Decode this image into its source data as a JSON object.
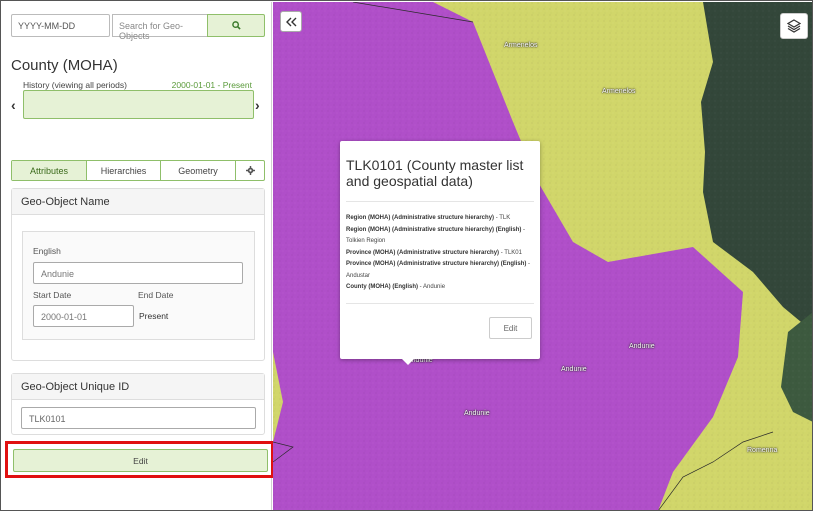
{
  "toolbar": {
    "date_placeholder": "YYYY-MM-DD",
    "search_placeholder": "Search for Geo-Objects",
    "search_icon": "search-icon"
  },
  "geo_object": {
    "type_title": "County (MOHA)",
    "history_label": "History  (viewing all periods)",
    "history_range": "2000-01-01 - Present"
  },
  "tabs": [
    {
      "label": "Attributes",
      "active": true
    },
    {
      "label": "Hierarchies",
      "active": false
    },
    {
      "label": "Geometry",
      "active": false
    },
    {
      "label": "",
      "icon": "gear-icon",
      "active": false
    }
  ],
  "name_panel": {
    "heading": "Geo-Object Name",
    "locale_label": "English",
    "value": "Andunie",
    "start_label": "Start Date",
    "end_label": "End Date",
    "start_value": "2000-01-01",
    "end_value": "Present"
  },
  "uid_panel": {
    "heading": "Geo-Object Unique ID",
    "value": "TLK0101"
  },
  "edit_button": "Edit",
  "map": {
    "labels": [
      {
        "text": "Armenelos"
      },
      {
        "text": "Armenelos"
      },
      {
        "text": "Andunie"
      },
      {
        "text": "Andunie"
      },
      {
        "text": "Andunie"
      },
      {
        "text": "Andunie"
      },
      {
        "text": "Romenna"
      }
    ],
    "colors": {
      "county_fill": "#b04fc9",
      "base_yellow": "#d1d66a",
      "dark_green": "#33473a"
    }
  },
  "popup": {
    "title": "TLK0101 (County master list and geospatial data)",
    "rows": [
      {
        "key": "Region (MOHA) (Administrative structure hierarchy)",
        "value": "TLK"
      },
      {
        "key": "Region (MOHA) (Administrative structure hierarchy) (English)",
        "value": "Tolkien Region"
      },
      {
        "key": "Province (MOHA) (Administrative structure hierarchy)",
        "value": "TLK01"
      },
      {
        "key": "Province (MOHA) (Administrative structure hierarchy) (English)",
        "value": "Andustar"
      },
      {
        "key": "County (MOHA) (English)",
        "value": "Andunie"
      }
    ],
    "edit_label": "Edit"
  }
}
